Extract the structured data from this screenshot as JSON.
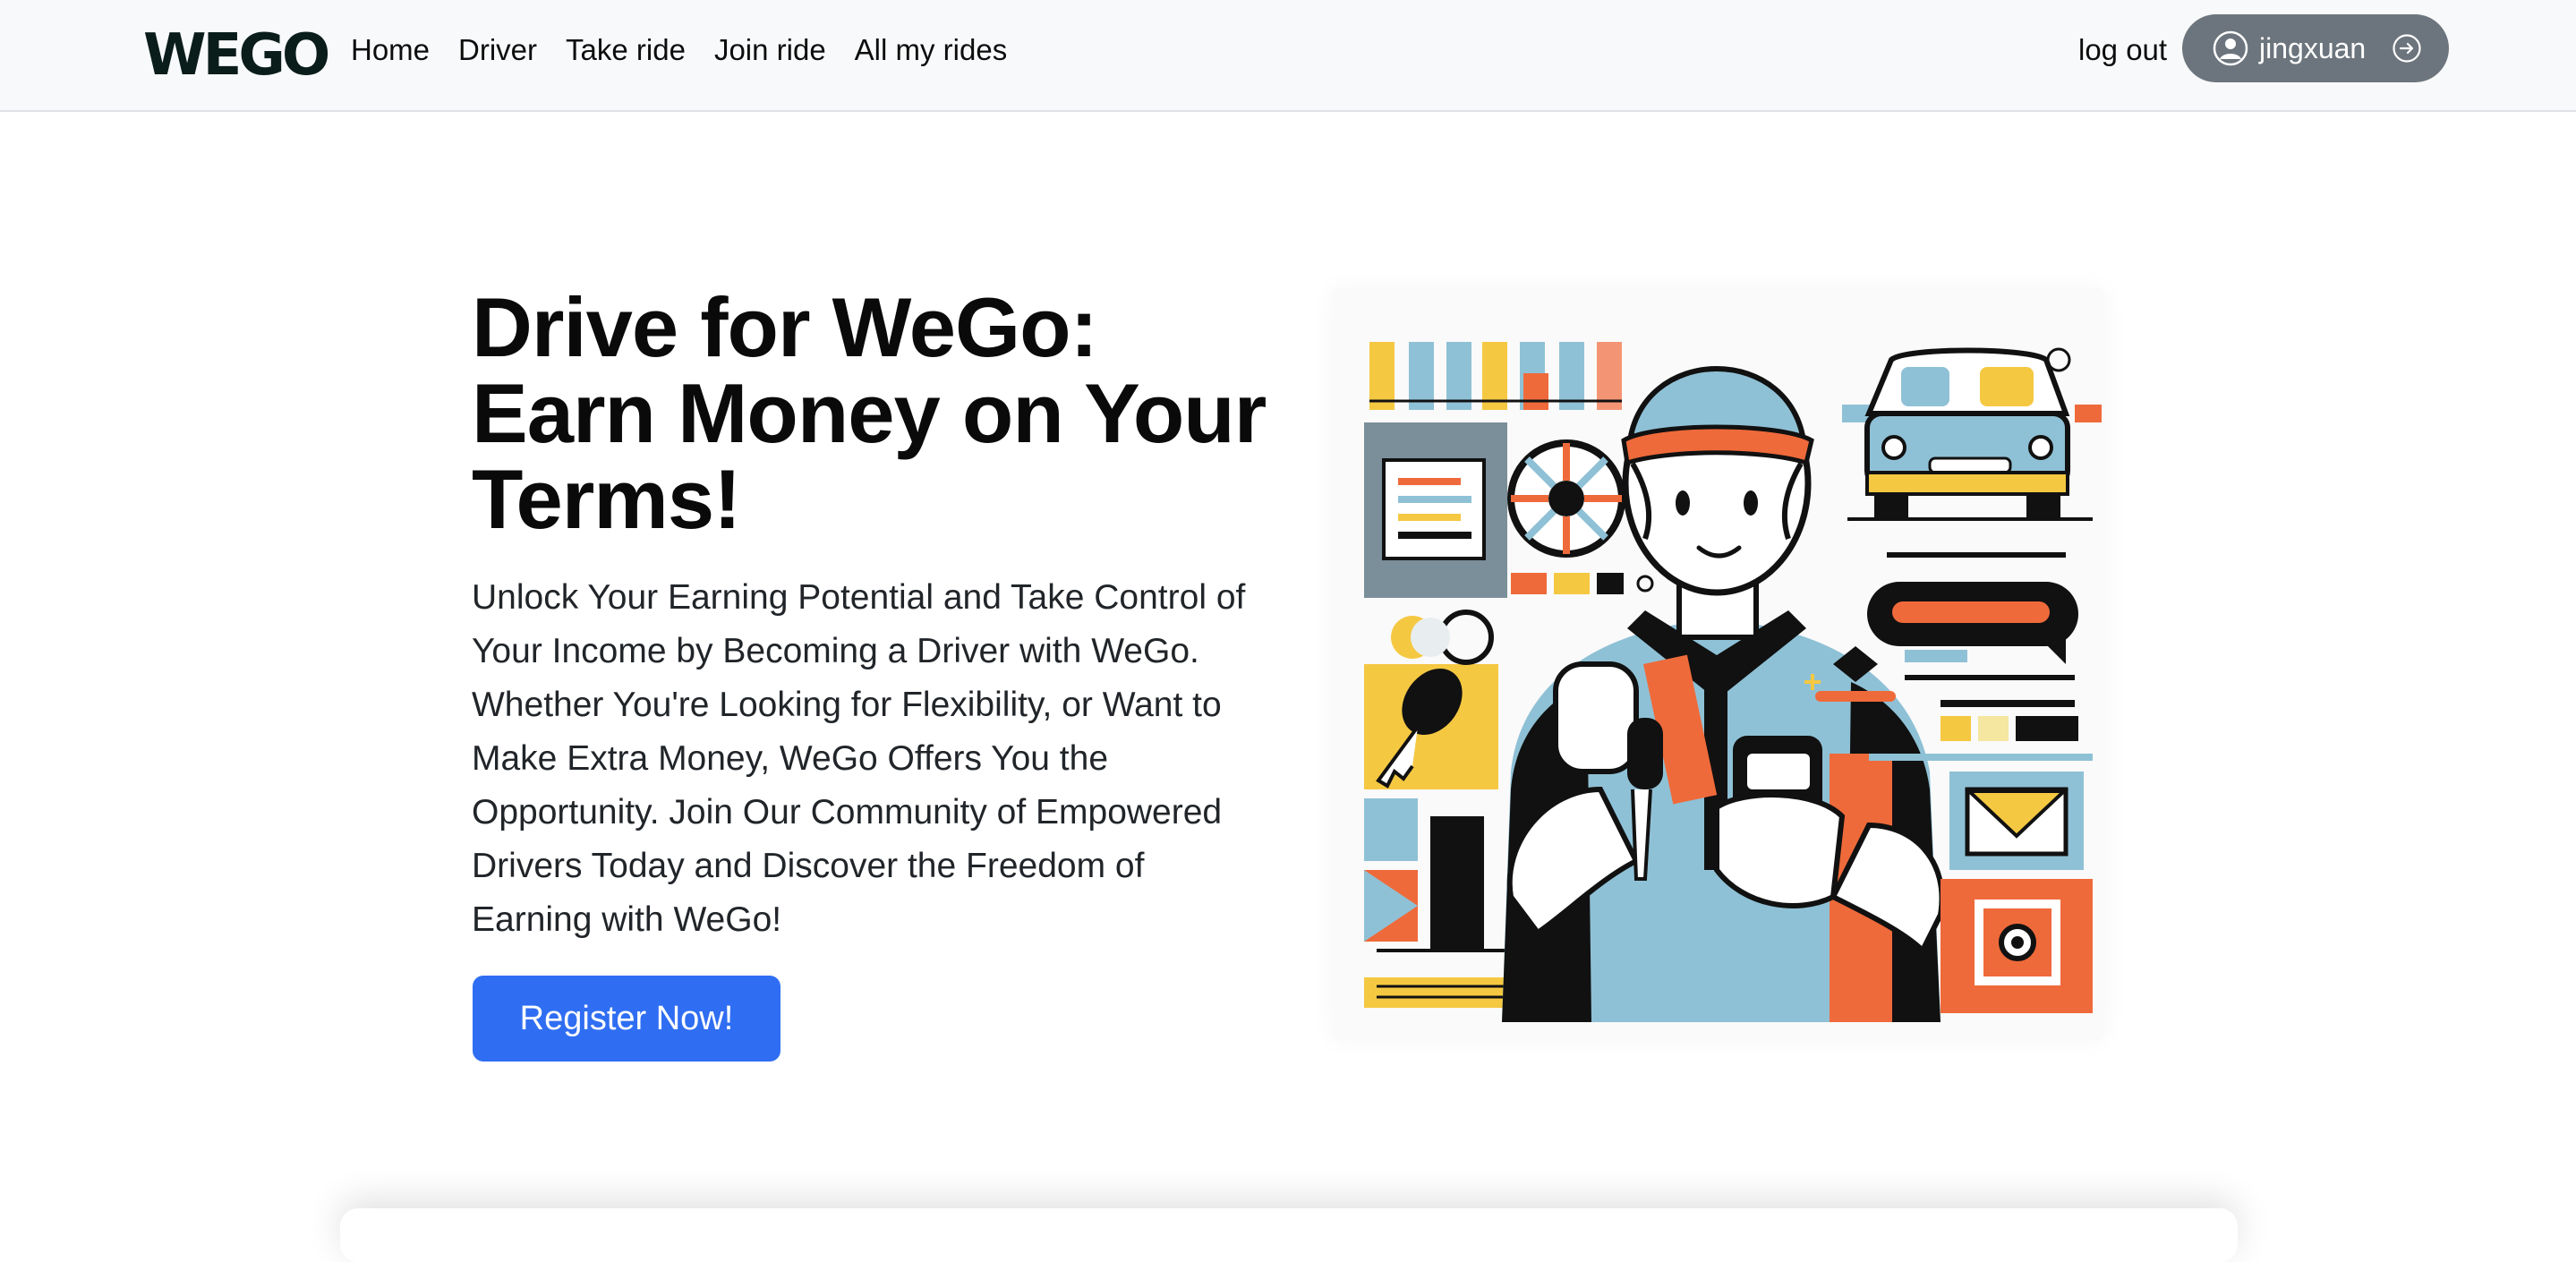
{
  "brand": "WEGO",
  "nav": {
    "links": [
      "Home",
      "Driver",
      "Take ride",
      "Join ride",
      "All my rides"
    ],
    "logout": "log out",
    "user": "jingxuan"
  },
  "hero": {
    "title": "Drive for WeGo: Earn Money on Your Terms!",
    "body": "Unlock Your Earning Potential and Take Control of Your Income by Becoming a Driver with WeGo. Whether You're Looking for Flexibility, or Want to Make Extra Money, WeGo Offers You the Opportunity. Join Our Community of Empowered Drivers Today and Discover the Freedom of Earning with WeGo!",
    "cta": "Register Now!"
  },
  "icons": {
    "user": "user-circle-icon",
    "logout": "arrow-right-circle-icon"
  },
  "colors": {
    "primary": "#2f6ef2",
    "pill": "#6c757d",
    "navbar": "#f8f9fa",
    "orange": "#ef6a3a",
    "yellow": "#f5c842",
    "lightblue": "#8fc1d6",
    "dark": "#111827"
  }
}
